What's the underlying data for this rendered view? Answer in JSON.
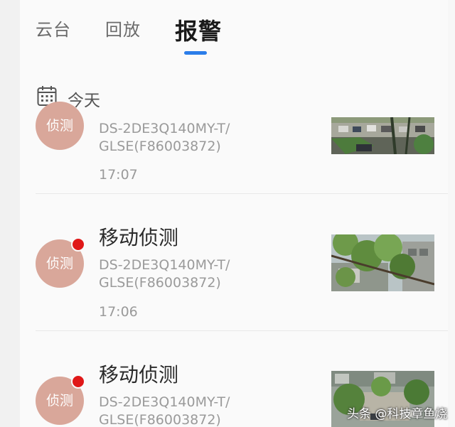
{
  "tabs": [
    {
      "label": "云台",
      "active": false
    },
    {
      "label": "回放",
      "active": false
    },
    {
      "label": "报警",
      "active": true
    }
  ],
  "date_header": {
    "label": "今天",
    "icon": "calendar-icon"
  },
  "alarms": [
    {
      "avatar_text": "侦测",
      "title": "",
      "device_line1": "DS-2DE3Q140MY-T/",
      "device_line2": "GLSE(F86003872)",
      "time": "17:07",
      "unread": false,
      "thumbnail": "parking-lot-camera-thumbnail"
    },
    {
      "avatar_text": "侦测",
      "title": "移动侦测",
      "device_line1": "DS-2DE3Q140MY-T/",
      "device_line2": "GLSE(F86003872)",
      "time": "17:06",
      "unread": true,
      "thumbnail": "tree-camera-thumbnail"
    },
    {
      "avatar_text": "侦测",
      "title": "移动侦测",
      "device_line1": "DS-2DE3Q140MY-T/",
      "device_line2": "GLSE(F86003872)",
      "time": "",
      "unread": true,
      "thumbnail": "courtyard-camera-thumbnail"
    }
  ],
  "watermark": "头条 @科技章鱼烧",
  "colors": {
    "accent": "#2b7de9",
    "avatar": "#d9a79a",
    "unread": "#e01818"
  }
}
